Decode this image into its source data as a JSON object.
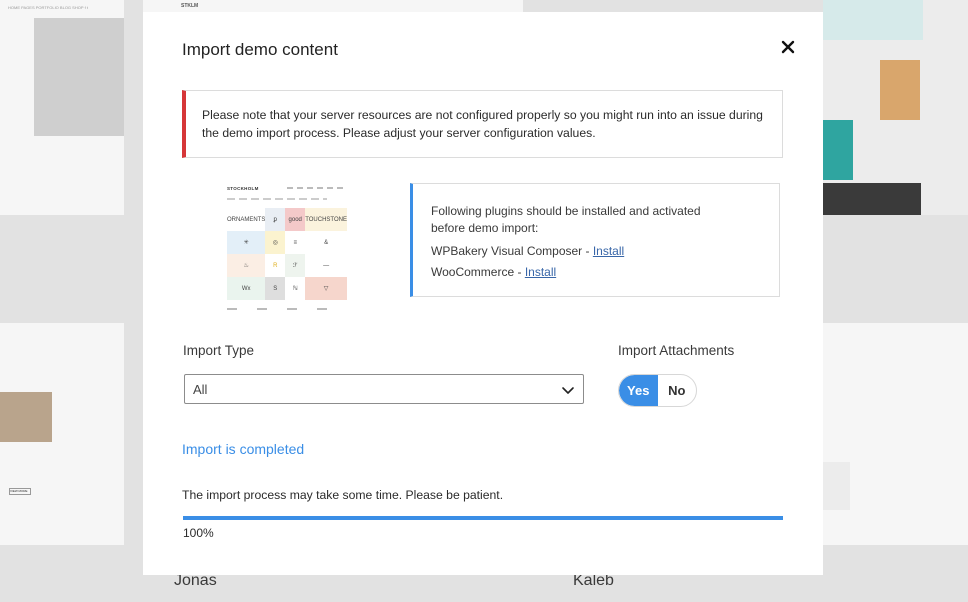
{
  "background": {
    "top_nav": [
      "HOME",
      "PAGES",
      "PORTFOLIO",
      "BLOG",
      "SHOP",
      "f",
      "t"
    ],
    "top_logo": "STKLM",
    "member_names": [
      "Jonas",
      "Kaleb"
    ],
    "site_button": "VIEW MORE"
  },
  "modal": {
    "title": "Import demo content",
    "close_icon": "close-icon",
    "notice": "Please note that your server resources are not configured properly so you might run into an issue during the demo import process. Please adjust your server configuration values.",
    "notice_color": "#d63638",
    "preview": {
      "brand": "STOCKHOLM",
      "cells": [
        "ORNAMENTS",
        "ꝑ",
        "good",
        "TOUCHSTONE",
        "✳",
        "◎",
        "≡",
        "&",
        "♨",
        "R",
        "ℱ",
        "—",
        "Wx",
        "S",
        "ℕ",
        "▽"
      ]
    },
    "plugins": {
      "intro": "Following plugins should be installed and activated before demo import:",
      "items": [
        {
          "name": "WPBakery Visual Composer",
          "link": "Install"
        },
        {
          "name": "WooCommerce",
          "link": "Install"
        }
      ],
      "separator": " - "
    },
    "import_type": {
      "label": "Import Type",
      "selected": "All"
    },
    "import_attachments": {
      "label": "Import Attachments",
      "yes": "Yes",
      "no": "No",
      "selected": "Yes"
    },
    "status": "Import is completed",
    "hint": "The import process may take some time. Please be patient.",
    "progress": 1.0,
    "progress_label": "100%",
    "accent_color": "#3a8ee6"
  }
}
